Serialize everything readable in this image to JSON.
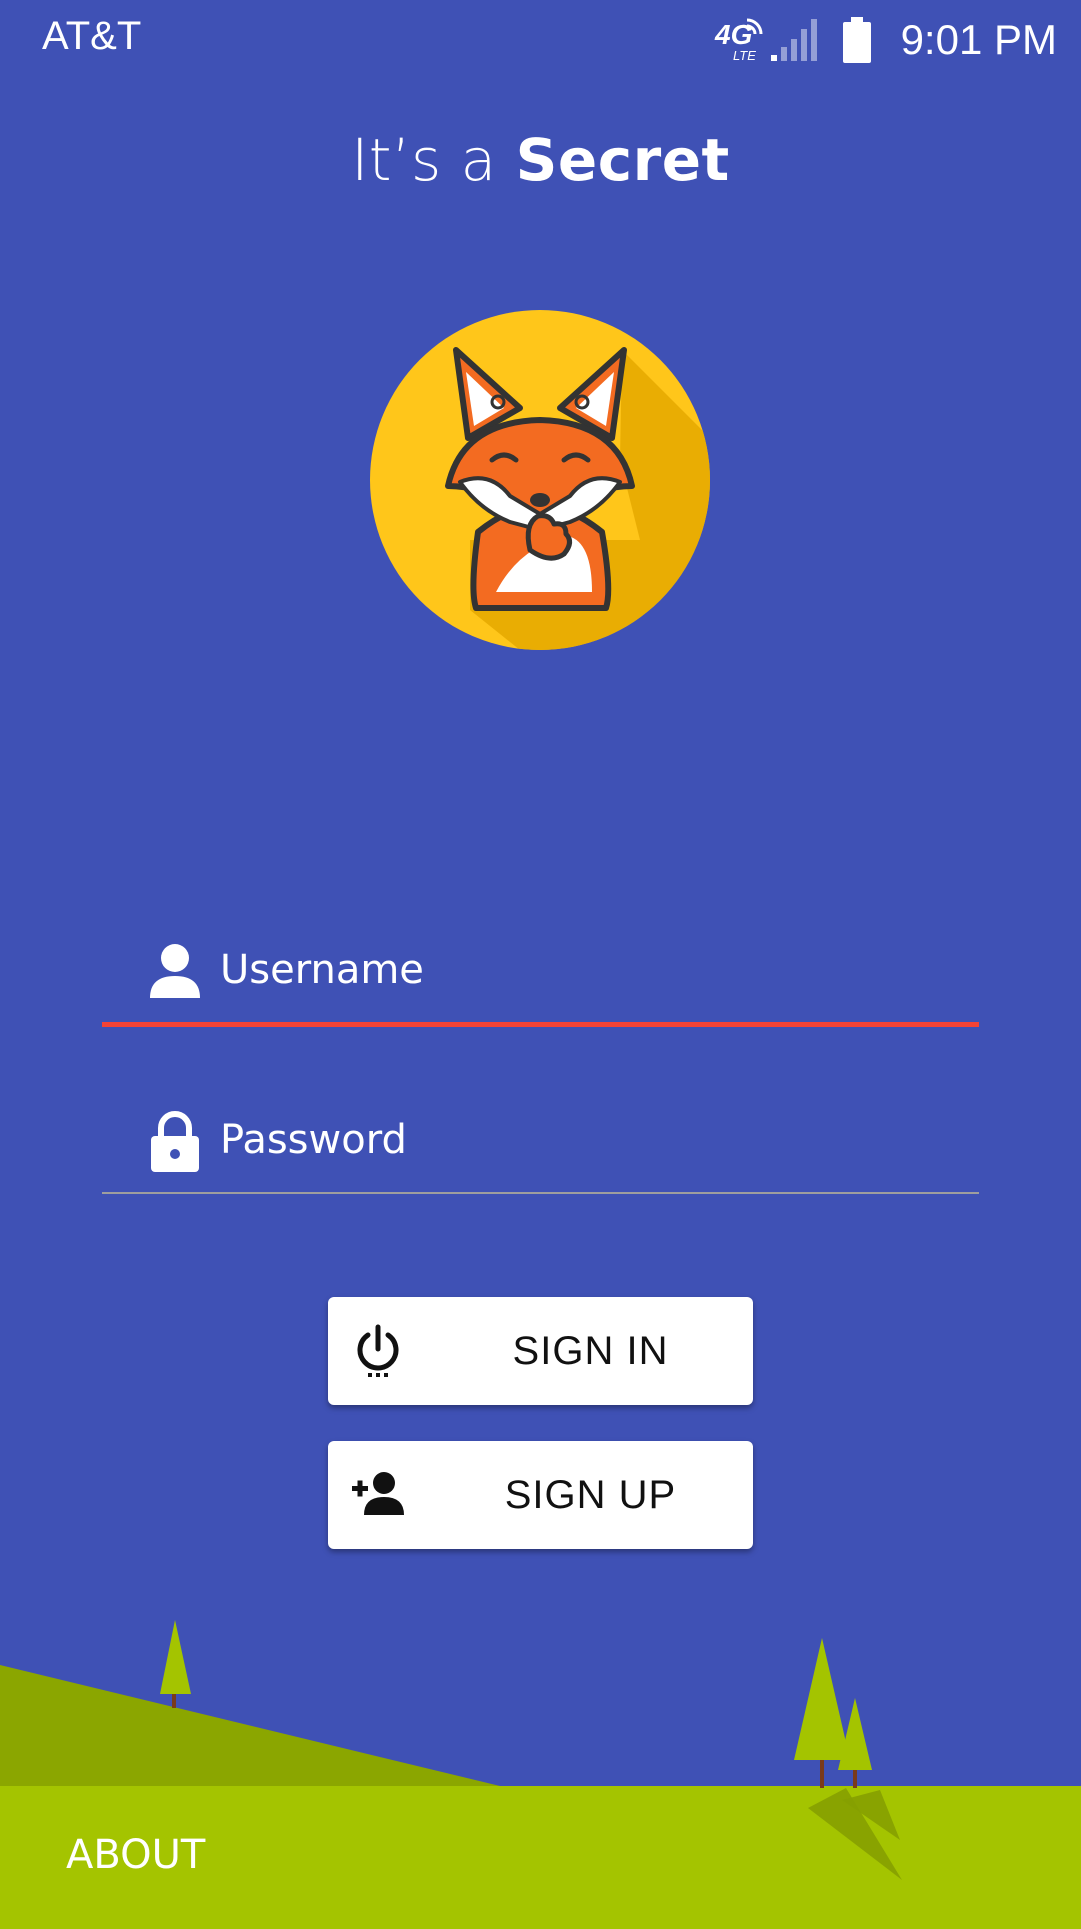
{
  "status_bar": {
    "carrier": "AT&T",
    "network_badge": "4G",
    "network_sub": "LTE",
    "time": "9:01 PM",
    "icons": [
      "network-4g-lte-icon",
      "signal-icon",
      "battery-icon"
    ]
  },
  "header": {
    "title_regular": "It’s a ",
    "title_bold": "Secret"
  },
  "logo": {
    "icon": "fox-shush-logo",
    "circle_color": "#FFC61A",
    "fox_color": "#F36B21"
  },
  "form": {
    "username": {
      "placeholder": "Username",
      "value": "",
      "icon": "person-icon",
      "underline_color": "#F44336"
    },
    "password": {
      "placeholder": "Password",
      "value": "",
      "icon": "lock-icon",
      "underline_color": "#9E9E9E"
    }
  },
  "buttons": {
    "sign_in": {
      "label": "SIGN IN",
      "icon": "power-icon"
    },
    "sign_up": {
      "label": "SIGN UP",
      "icon": "add-person-icon"
    }
  },
  "footer": {
    "about_label": "ABOUT"
  },
  "colors": {
    "background": "#3F51B5",
    "grass_light": "#A4C400",
    "grass_dark": "#8BA600",
    "accent": "#F44336"
  }
}
